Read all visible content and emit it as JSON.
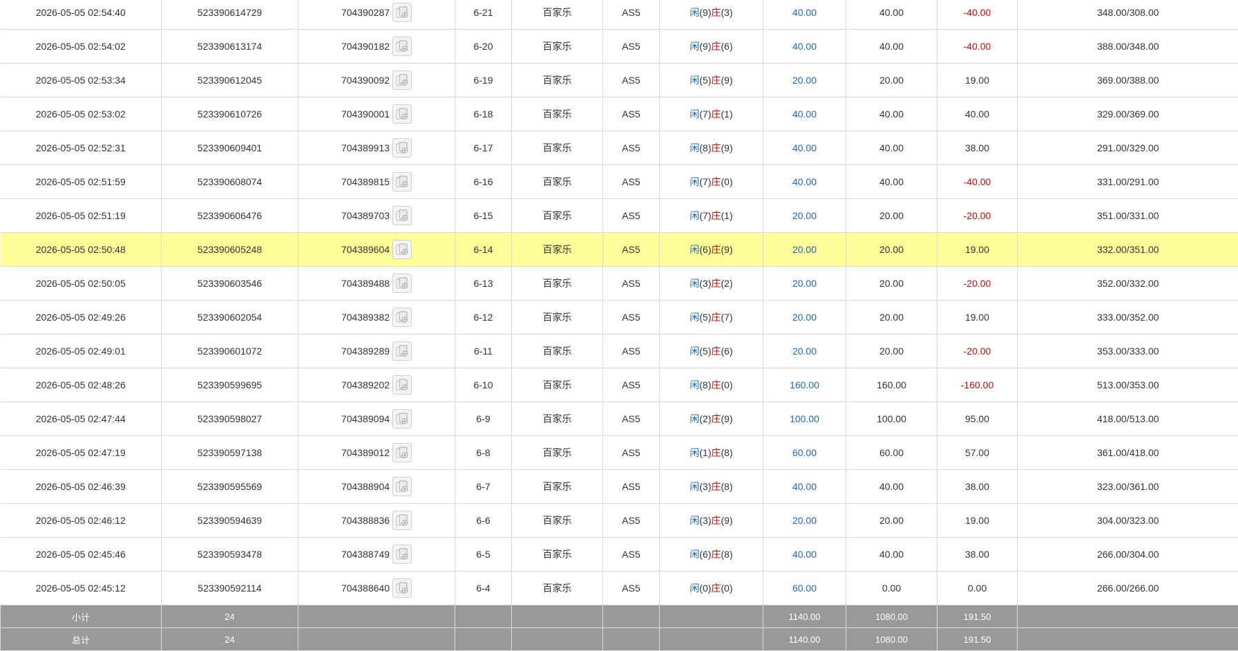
{
  "colors": {
    "player": "#1a66cc",
    "banker": "#e00000",
    "highlight": "#fefe99",
    "footer_bg": "#999999"
  },
  "icons": {
    "detail": "card-detail-icon"
  },
  "rows": [
    {
      "time": "2026-05-05 02:54:40",
      "order_no": "523390614729",
      "bet_id": "704390287",
      "round": "6-21",
      "game": "百家乐",
      "table": "AS5",
      "player_label": "闲",
      "player_score": "(9)",
      "banker_label": "庄",
      "banker_score": "(3)",
      "bet": "40.00",
      "valid_bet": "40.00",
      "win_loss": "-40.00",
      "win_loss_negative": true,
      "balance": "348.00/308.00"
    },
    {
      "time": "2026-05-05 02:54:02",
      "order_no": "523390613174",
      "bet_id": "704390182",
      "round": "6-20",
      "game": "百家乐",
      "table": "AS5",
      "player_label": "闲",
      "player_score": "(9)",
      "banker_label": "庄",
      "banker_score": "(6)",
      "bet": "40.00",
      "valid_bet": "40.00",
      "win_loss": "-40.00",
      "win_loss_negative": true,
      "balance": "388.00/348.00"
    },
    {
      "time": "2026-05-05 02:53:34",
      "order_no": "523390612045",
      "bet_id": "704390092",
      "round": "6-19",
      "game": "百家乐",
      "table": "AS5",
      "player_label": "闲",
      "player_score": "(5)",
      "banker_label": "庄",
      "banker_score": "(9)",
      "bet": "20.00",
      "valid_bet": "20.00",
      "win_loss": "19.00",
      "win_loss_negative": false,
      "balance": "369.00/388.00"
    },
    {
      "time": "2026-05-05 02:53:02",
      "order_no": "523390610726",
      "bet_id": "704390001",
      "round": "6-18",
      "game": "百家乐",
      "table": "AS5",
      "player_label": "闲",
      "player_score": "(7)",
      "banker_label": "庄",
      "banker_score": "(1)",
      "bet": "40.00",
      "valid_bet": "40.00",
      "win_loss": "40.00",
      "win_loss_negative": false,
      "balance": "329.00/369.00"
    },
    {
      "time": "2026-05-05 02:52:31",
      "order_no": "523390609401",
      "bet_id": "704389913",
      "round": "6-17",
      "game": "百家乐",
      "table": "AS5",
      "player_label": "闲",
      "player_score": "(8)",
      "banker_label": "庄",
      "banker_score": "(9)",
      "bet": "40.00",
      "valid_bet": "40.00",
      "win_loss": "38.00",
      "win_loss_negative": false,
      "balance": "291.00/329.00"
    },
    {
      "time": "2026-05-05 02:51:59",
      "order_no": "523390608074",
      "bet_id": "704389815",
      "round": "6-16",
      "game": "百家乐",
      "table": "AS5",
      "player_label": "闲",
      "player_score": "(7)",
      "banker_label": "庄",
      "banker_score": "(0)",
      "bet": "40.00",
      "valid_bet": "40.00",
      "win_loss": "-40.00",
      "win_loss_negative": true,
      "balance": "331.00/291.00"
    },
    {
      "time": "2026-05-05 02:51:19",
      "order_no": "523390606476",
      "bet_id": "704389703",
      "round": "6-15",
      "game": "百家乐",
      "table": "AS5",
      "player_label": "闲",
      "player_score": "(7)",
      "banker_label": "庄",
      "banker_score": "(1)",
      "bet": "20.00",
      "valid_bet": "20.00",
      "win_loss": "-20.00",
      "win_loss_negative": true,
      "balance": "351.00/331.00"
    },
    {
      "time": "2026-05-05 02:50:48",
      "order_no": "523390605248",
      "bet_id": "704389604",
      "round": "6-14",
      "game": "百家乐",
      "table": "AS5",
      "player_label": "闲",
      "player_score": "(6)",
      "banker_label": "庄",
      "banker_score": "(9)",
      "bet": "20.00",
      "valid_bet": "20.00",
      "win_loss": "19.00",
      "win_loss_negative": false,
      "balance": "332.00/351.00",
      "highlighted": true
    },
    {
      "time": "2026-05-05 02:50:05",
      "order_no": "523390603546",
      "bet_id": "704389488",
      "round": "6-13",
      "game": "百家乐",
      "table": "AS5",
      "player_label": "闲",
      "player_score": "(3)",
      "banker_label": "庄",
      "banker_score": "(2)",
      "bet": "20.00",
      "valid_bet": "20.00",
      "win_loss": "-20.00",
      "win_loss_negative": true,
      "balance": "352.00/332.00"
    },
    {
      "time": "2026-05-05 02:49:26",
      "order_no": "523390602054",
      "bet_id": "704389382",
      "round": "6-12",
      "game": "百家乐",
      "table": "AS5",
      "player_label": "闲",
      "player_score": "(5)",
      "banker_label": "庄",
      "banker_score": "(7)",
      "bet": "20.00",
      "valid_bet": "20.00",
      "win_loss": "19.00",
      "win_loss_negative": false,
      "balance": "333.00/352.00"
    },
    {
      "time": "2026-05-05 02:49:01",
      "order_no": "523390601072",
      "bet_id": "704389289",
      "round": "6-11",
      "game": "百家乐",
      "table": "AS5",
      "player_label": "闲",
      "player_score": "(5)",
      "banker_label": "庄",
      "banker_score": "(6)",
      "bet": "20.00",
      "valid_bet": "20.00",
      "win_loss": "-20.00",
      "win_loss_negative": true,
      "balance": "353.00/333.00"
    },
    {
      "time": "2026-05-05 02:48:26",
      "order_no": "523390599695",
      "bet_id": "704389202",
      "round": "6-10",
      "game": "百家乐",
      "table": "AS5",
      "player_label": "闲",
      "player_score": "(8)",
      "banker_label": "庄",
      "banker_score": "(0)",
      "bet": "160.00",
      "valid_bet": "160.00",
      "win_loss": "-160.00",
      "win_loss_negative": true,
      "balance": "513.00/353.00"
    },
    {
      "time": "2026-05-05 02:47:44",
      "order_no": "523390598027",
      "bet_id": "704389094",
      "round": "6-9",
      "game": "百家乐",
      "table": "AS5",
      "player_label": "闲",
      "player_score": "(2)",
      "banker_label": "庄",
      "banker_score": "(9)",
      "bet": "100.00",
      "valid_bet": "100.00",
      "win_loss": "95.00",
      "win_loss_negative": false,
      "balance": "418.00/513.00"
    },
    {
      "time": "2026-05-05 02:47:19",
      "order_no": "523390597138",
      "bet_id": "704389012",
      "round": "6-8",
      "game": "百家乐",
      "table": "AS5",
      "player_label": "闲",
      "player_score": "(1)",
      "banker_label": "庄",
      "banker_score": "(8)",
      "bet": "60.00",
      "valid_bet": "60.00",
      "win_loss": "57.00",
      "win_loss_negative": false,
      "balance": "361.00/418.00"
    },
    {
      "time": "2026-05-05 02:46:39",
      "order_no": "523390595569",
      "bet_id": "704388904",
      "round": "6-7",
      "game": "百家乐",
      "table": "AS5",
      "player_label": "闲",
      "player_score": "(3)",
      "banker_label": "庄",
      "banker_score": "(8)",
      "bet": "40.00",
      "valid_bet": "40.00",
      "win_loss": "38.00",
      "win_loss_negative": false,
      "balance": "323.00/361.00"
    },
    {
      "time": "2026-05-05 02:46:12",
      "order_no": "523390594639",
      "bet_id": "704388836",
      "round": "6-6",
      "game": "百家乐",
      "table": "AS5",
      "player_label": "闲",
      "player_score": "(3)",
      "banker_label": "庄",
      "banker_score": "(9)",
      "bet": "20.00",
      "valid_bet": "20.00",
      "win_loss": "19.00",
      "win_loss_negative": false,
      "balance": "304.00/323.00"
    },
    {
      "time": "2026-05-05 02:45:46",
      "order_no": "523390593478",
      "bet_id": "704388749",
      "round": "6-5",
      "game": "百家乐",
      "table": "AS5",
      "player_label": "闲",
      "player_score": "(6)",
      "banker_label": "庄",
      "banker_score": "(8)",
      "bet": "40.00",
      "valid_bet": "40.00",
      "win_loss": "38.00",
      "win_loss_negative": false,
      "balance": "266.00/304.00"
    },
    {
      "time": "2026-05-05 02:45:12",
      "order_no": "523390592114",
      "bet_id": "704388640",
      "round": "6-4",
      "game": "百家乐",
      "table": "AS5",
      "player_label": "闲",
      "player_score": "(0)",
      "banker_label": "庄",
      "banker_score": "(0)",
      "bet": "60.00",
      "valid_bet": "0.00",
      "win_loss": "0.00",
      "win_loss_negative": false,
      "balance": "266.00/266.00"
    }
  ],
  "subtotal": {
    "label": "小计",
    "count": "24",
    "bet": "1140.00",
    "valid_bet": "1080.00",
    "win_loss": "191.50"
  },
  "total": {
    "label": "总计",
    "count": "24",
    "bet": "1140.00",
    "valid_bet": "1080.00",
    "win_loss": "191.50"
  }
}
